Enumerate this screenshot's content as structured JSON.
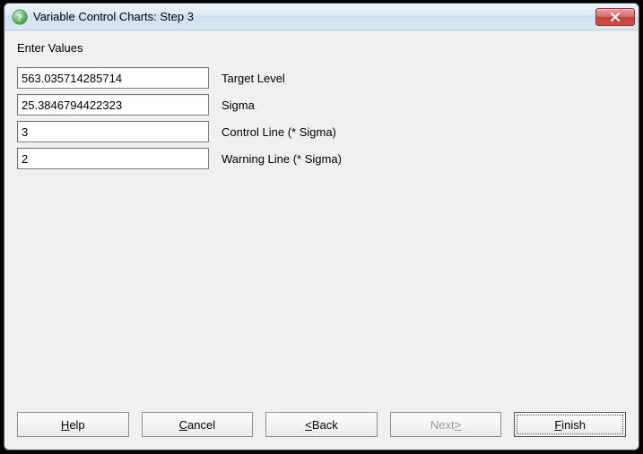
{
  "window": {
    "title": "Variable Control Charts: Step 3"
  },
  "section_label": "Enter Values",
  "fields": {
    "target_level": {
      "value": "563.035714285714",
      "label": "Target Level"
    },
    "sigma": {
      "value": "25.3846794422323",
      "label": "Sigma"
    },
    "control_line": {
      "value": "3",
      "label": "Control Line (* Sigma)"
    },
    "warning_line": {
      "value": "2",
      "label": "Warning Line (* Sigma)"
    }
  },
  "buttons": {
    "help": {
      "pre": "",
      "mn": "H",
      "post": "elp"
    },
    "cancel": {
      "pre": "",
      "mn": "C",
      "post": "ancel"
    },
    "back": {
      "pre": "",
      "mn": "<",
      "post": " Back"
    },
    "next": {
      "pre": "Next ",
      "mn": ">",
      "post": ""
    },
    "finish": {
      "pre": "",
      "mn": "F",
      "post": "inish"
    }
  }
}
